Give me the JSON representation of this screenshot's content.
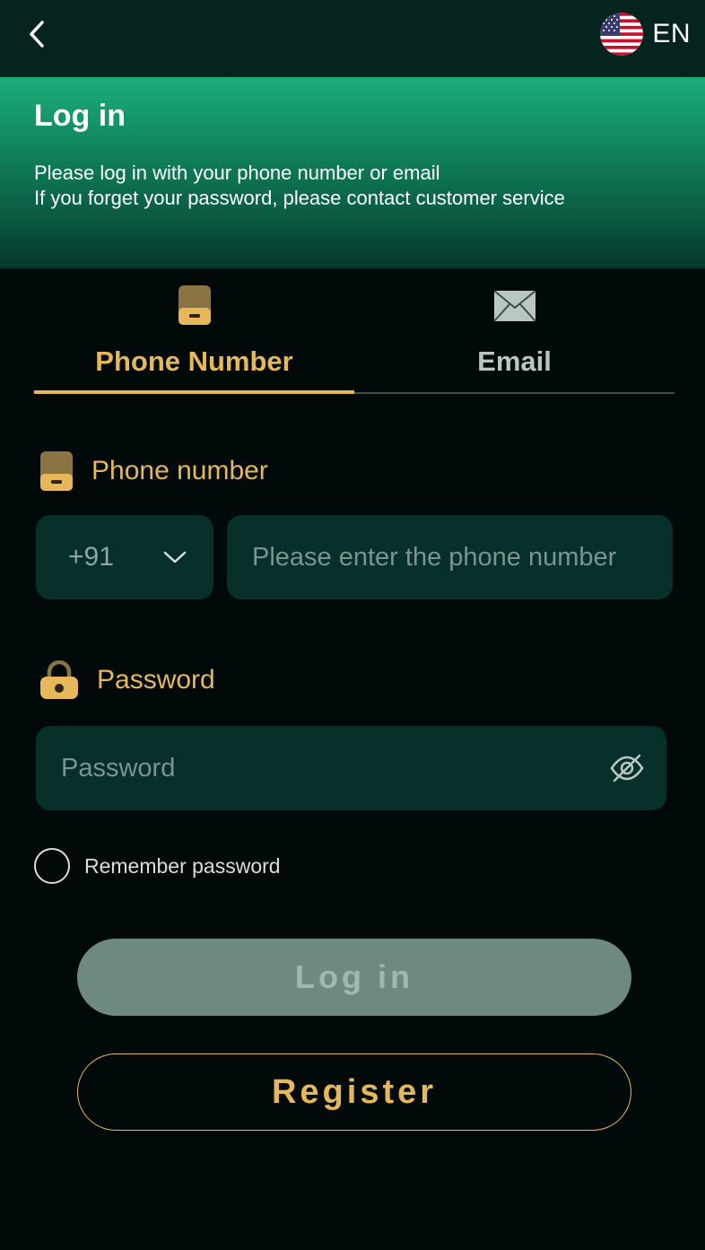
{
  "header": {
    "back_icon": "chevron-left-icon",
    "language": "EN",
    "flag_icon": "us-flag-icon"
  },
  "hero": {
    "title": "Log in",
    "line1": "Please log in with your phone number or email",
    "line2": "If you forget your password, please contact customer service"
  },
  "tabs": [
    {
      "label": "Phone Number",
      "icon": "phone-icon",
      "active": true
    },
    {
      "label": "Email",
      "icon": "envelope-icon",
      "active": false
    }
  ],
  "phone": {
    "label": "Phone number",
    "country_code": "+91",
    "placeholder": "Please enter the phone number"
  },
  "password": {
    "label": "Password",
    "placeholder": "Password"
  },
  "remember": {
    "label": "Remember password",
    "checked": false
  },
  "buttons": {
    "login": "Log in",
    "register": "Register"
  },
  "colors": {
    "accent": "#e6b85a",
    "hero_green": "#1cae7a",
    "field_bg": "#07302a",
    "background": "#020a09"
  }
}
